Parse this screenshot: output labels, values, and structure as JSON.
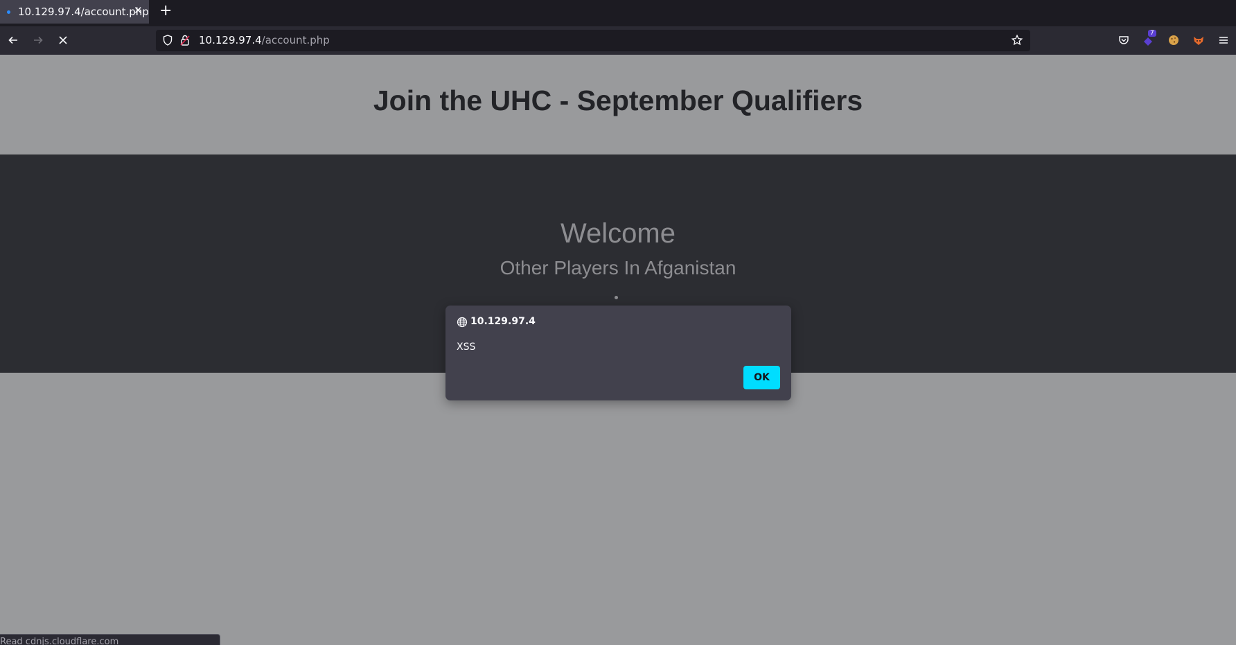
{
  "browser": {
    "tab": {
      "title": "10.129.97.4/account.php"
    },
    "url": {
      "host": "10.129.97.4",
      "path": "/account.php"
    },
    "extension_badge": "7"
  },
  "page": {
    "title": "Join the UHC - September Qualifiers",
    "welcome": "Welcome",
    "subheading": "Other Players In Afganistan"
  },
  "dialog": {
    "host": "10.129.97.4",
    "message": "XSS",
    "ok_label": "OK"
  },
  "status_bar": {
    "text": "Read cdnjs.cloudflare.com"
  },
  "colors": {
    "accent": "#00ddff",
    "page_bg": "#999a9c",
    "section_bg": "#2c2d32"
  }
}
